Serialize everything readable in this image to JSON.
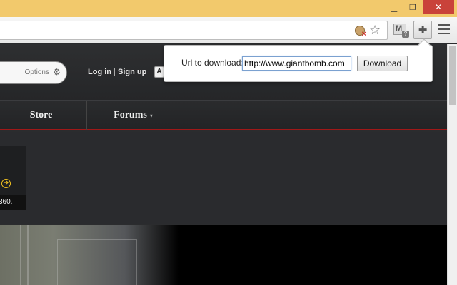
{
  "window": {
    "minimize_glyph": "▁",
    "maximize_glyph": "❐",
    "close_glyph": "✕"
  },
  "toolbar": {
    "icons": [
      "cookie-blocked-icon",
      "star-icon",
      "gmail-checker-icon",
      "extension-puzzle-icon",
      "hamburger-menu-icon"
    ],
    "star_glyph": "☆",
    "gmail_letter": "M",
    "gmail_badge": "?",
    "puzzle_glyph": "✚",
    "cookie_x": "✕"
  },
  "page": {
    "search": {
      "options_label": "Options",
      "gear_glyph": "⚙"
    },
    "auth": {
      "login": "Log in",
      "separator": " | ",
      "signup": "Sign up",
      "box_letter": "A"
    },
    "nav": {
      "items": [
        {
          "label": "Store"
        },
        {
          "label": "Forums",
          "caret": "▾"
        }
      ]
    },
    "card": {
      "arrow_glyph": "➔",
      "caption": "360."
    },
    "accent_color": "#a01818"
  },
  "popup": {
    "label": "Url to download:",
    "url_value": "http://www.giantbomb.com",
    "download_label": "Download"
  }
}
